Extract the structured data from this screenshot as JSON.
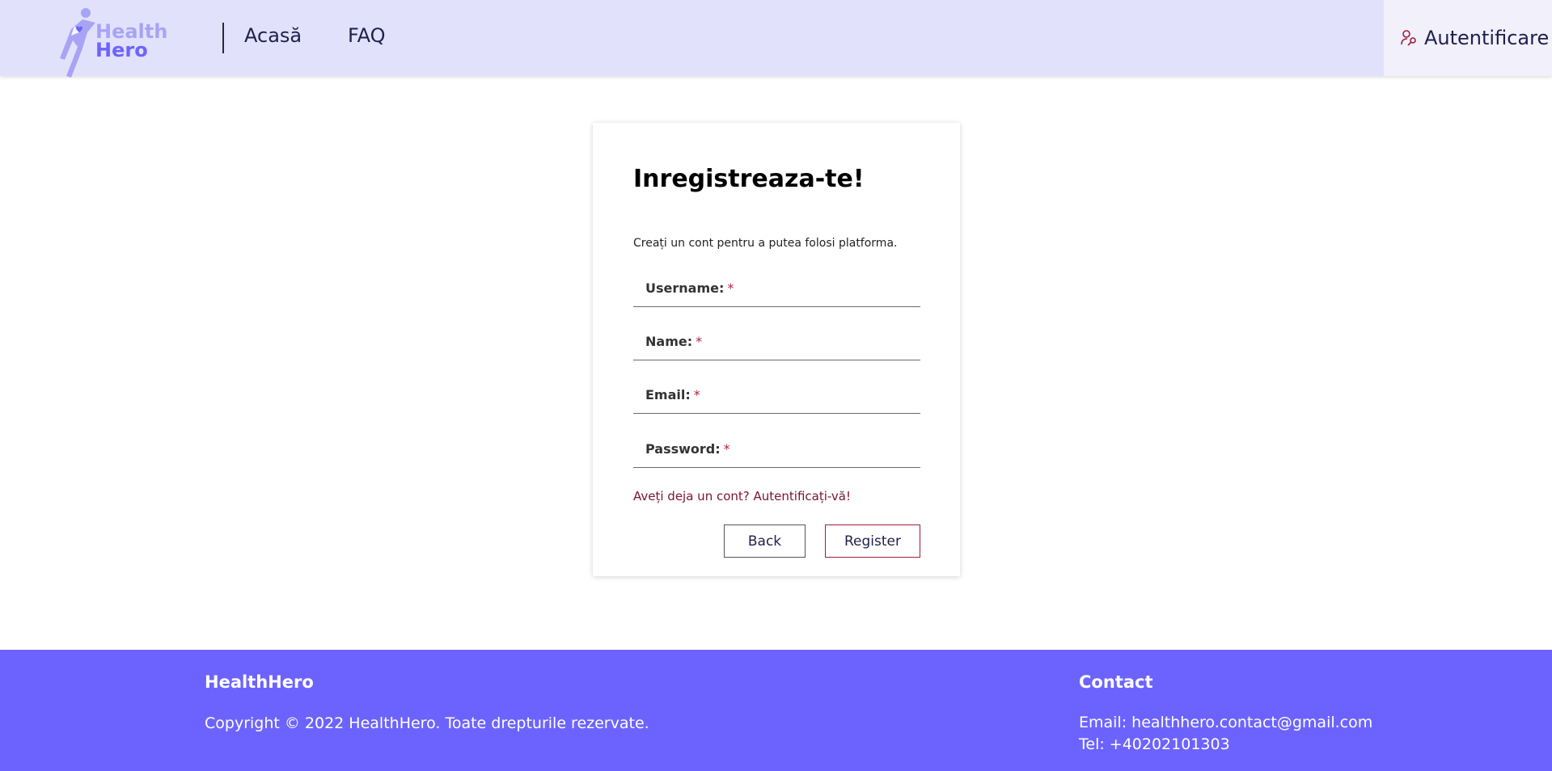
{
  "header": {
    "logo_line1": "Health",
    "logo_line2": "Hero",
    "nav": {
      "home": "Acasă",
      "faq": "FAQ"
    },
    "auth_label": "Autentificare"
  },
  "form": {
    "title": "Inregistreaza-te!",
    "subtitle": "Creați un cont pentru a putea folosi platforma.",
    "fields": [
      {
        "label": "Username:",
        "required": "*"
      },
      {
        "label": "Name:",
        "required": "*"
      },
      {
        "label": "Email:",
        "required": "*"
      },
      {
        "label": "Password:",
        "required": "*"
      }
    ],
    "login_link": "Aveți deja un cont? Autentificați-vă!",
    "back_label": "Back",
    "register_label": "Register"
  },
  "footer": {
    "brand": "HealthHero",
    "copyright": "Copyright © 2022 HealthHero. Toate drepturile rezervate.",
    "contact_title": "Contact",
    "email": "Email: healthhero.contact@gmail.com",
    "tel": "Tel: +40202101303"
  },
  "colors": {
    "header_bg": "#e2e1fc",
    "brand_purple": "#6c63ff",
    "accent_red": "#a01c3a",
    "nav_text": "#1f1f4d"
  },
  "icons": {
    "logo": "health-hero-logo",
    "auth": "user-key-icon"
  }
}
